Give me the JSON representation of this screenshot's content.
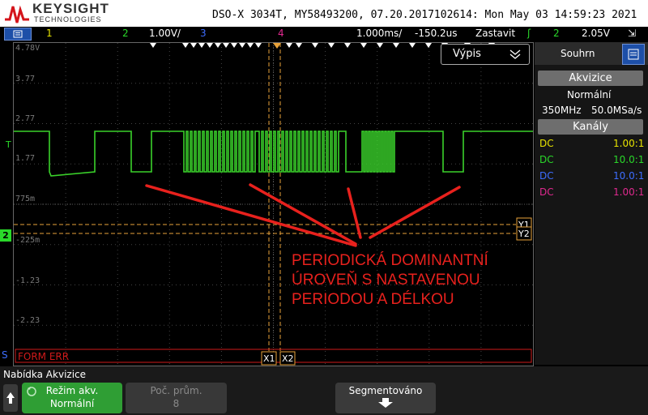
{
  "header": {
    "brand": "KEYSIGHT",
    "brand_sub": "TECHNOLOGIES",
    "instrument_info": "DSO-X 3034T, MY58493200, 07.20.2017102614: Mon May 03 14:59:23 2021"
  },
  "toolbar": {
    "ch1": "1",
    "ch2": "2",
    "ch2_scale": "1.00V/",
    "ch3": "3",
    "ch4": "4",
    "timebase": "1.000ms/",
    "delay": "-150.2us",
    "run_state": "Zastavit",
    "trig_ch": "2",
    "trig_level": "2.05V"
  },
  "grid": {
    "y_labels": [
      "4.78V",
      "3.77",
      "2.77",
      "1.77",
      "775m",
      "-225m",
      "-1.23",
      "-2.23"
    ],
    "cursor_x1": "X1",
    "cursor_x2": "X2",
    "cursor_y1": "Y1",
    "cursor_y2": "Y2",
    "ground_marker": "2",
    "trig_marker": "T",
    "serial_label": "S",
    "serial_text": "FORM ERR",
    "vypis_label": "Výpis",
    "vypis_icon": "chevron-down-icon"
  },
  "annotation": {
    "lines": [
      "PERIODICKÁ DOMINANTNÍ",
      "ÚROVEŇ S NASTAVENOU",
      "PERIODOU A DÉLKOU"
    ]
  },
  "right_panel": {
    "tab_label": "Souhrn",
    "acquisition_title": "Akvizice",
    "acquisition_mode": "Normální",
    "bandwidth": "350MHz",
    "sample_rate": "50.0MSa/s",
    "channels_title": "Kanály",
    "channels": [
      {
        "coupling": "DC",
        "probe": "1.00:1",
        "color": "#e8e400"
      },
      {
        "coupling": "DC",
        "probe": "10.0:1",
        "color": "#2ad82a"
      },
      {
        "coupling": "DC",
        "probe": "10.0:1",
        "color": "#3d6dff"
      },
      {
        "coupling": "DC",
        "probe": "1.00:1",
        "color": "#e0298f"
      }
    ]
  },
  "softkeys": {
    "menu_title": "Nabídka Akvizice",
    "acq_mode_label": "Režim akv.",
    "acq_mode_value": "Normální",
    "avg_label": "Poč. prům.",
    "avg_value": "8",
    "segmented_label": "Segmentováno"
  },
  "colors": {
    "trace": "#3ad12a",
    "cursor": "#e8a23a",
    "annotation": "#e8211d"
  }
}
